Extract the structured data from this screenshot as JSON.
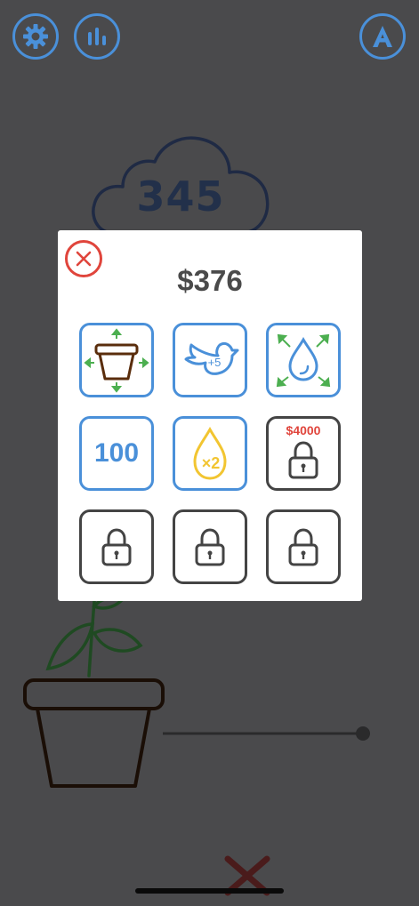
{
  "game": {
    "score": "345",
    "money": "$376"
  },
  "top_bar": {
    "settings_icon": "gear-icon",
    "stats_icon": "bar-chart-icon",
    "achievements_icon": "letter-a-icon"
  },
  "shop": {
    "close_icon": "close-x-icon",
    "items": [
      {
        "icon": "pot-expand-icon",
        "locked": false,
        "label": ""
      },
      {
        "icon": "bird-plus-5-icon",
        "locked": false,
        "label": "+5"
      },
      {
        "icon": "drop-expand-icon",
        "locked": false,
        "label": ""
      },
      {
        "icon": "number-100-icon",
        "locked": false,
        "label": "100"
      },
      {
        "icon": "drop-x2-icon",
        "locked": false,
        "label": "×2"
      },
      {
        "icon": "lock-icon",
        "locked": true,
        "price": "$4000"
      },
      {
        "icon": "lock-icon",
        "locked": true
      },
      {
        "icon": "lock-icon",
        "locked": true
      },
      {
        "icon": "lock-icon",
        "locked": true
      }
    ]
  },
  "colors": {
    "accent_blue": "#4a90d9",
    "close_red": "#e0453c",
    "price_red": "#e0453c",
    "water_yellow": "#f2c531",
    "leaf_green": "#2e7d32",
    "pot_brown": "#5a2d0c",
    "background": "#4a4a4c"
  }
}
